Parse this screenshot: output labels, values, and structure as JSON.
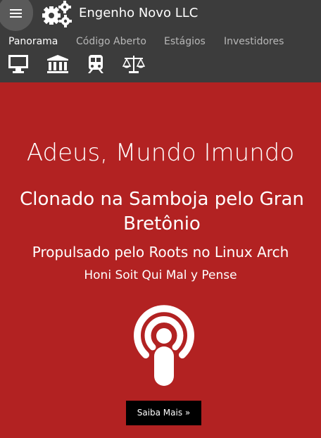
{
  "app": {
    "brand": "Engenho Novo LLC"
  },
  "nav": {
    "tabs": [
      {
        "label": "Panorama",
        "active": true
      },
      {
        "label": "Código Aberto",
        "active": false
      },
      {
        "label": "Estágios",
        "active": false
      },
      {
        "label": "Investidores",
        "active": false
      }
    ],
    "icons": [
      "desktop-icon",
      "bank-icon",
      "train-icon",
      "scales-icon"
    ]
  },
  "hero": {
    "title": "Adeus, Mundo Imundo",
    "subtitle": "Clonado na Samboja pelo Gran Bretônio",
    "tagline": "Propulsado pelo Roots no Linux Arch",
    "motto": "Honi Soit Qui Mal y Pense",
    "icon": "podcast-icon",
    "cta_label": "Saiba Mais »"
  },
  "colors": {
    "header_bg": "#3c3c3c",
    "hero_bg": "#b22222",
    "tab_active": "#ffffff",
    "tab_inactive": "#b7b7b7",
    "button_bg": "#000000"
  }
}
